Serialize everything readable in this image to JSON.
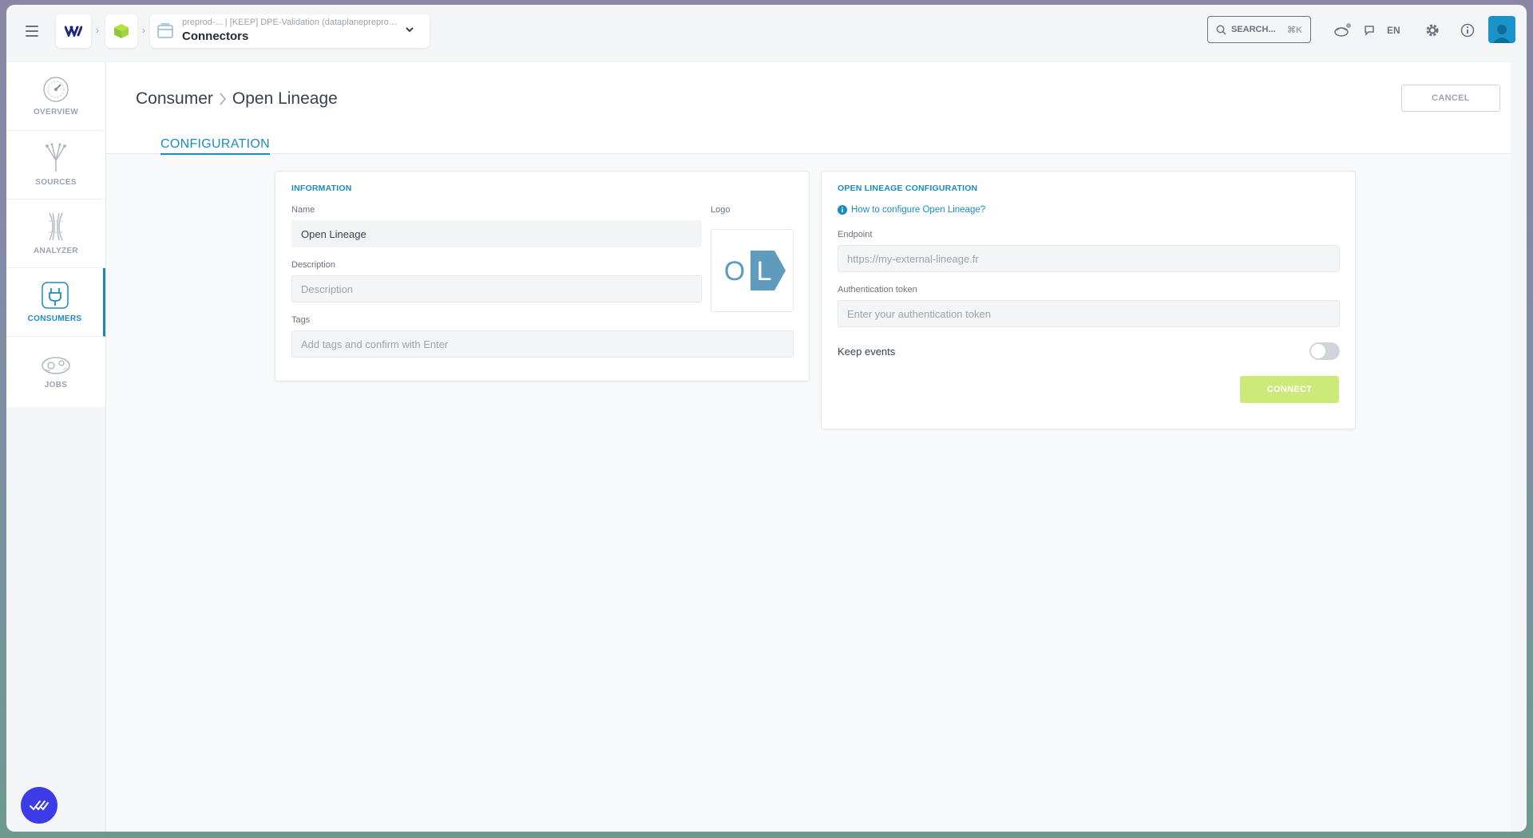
{
  "topbar": {
    "workspace_path": "preprod-...  | [KEEP] DPE-Validation (dataplanepreprod...",
    "workspace_title": "Connectors",
    "search_label": "SEARCH...",
    "search_shortcut": "⌘K",
    "language": "EN"
  },
  "sidebar": {
    "items": [
      {
        "label": "OVERVIEW",
        "icon": "speedometer-icon"
      },
      {
        "label": "SOURCES",
        "icon": "sources-icon"
      },
      {
        "label": "ANALYZER",
        "icon": "analyzer-icon"
      },
      {
        "label": "CONSUMERS",
        "icon": "plug-icon",
        "active": true
      },
      {
        "label": "JOBS",
        "icon": "jobs-icon"
      }
    ]
  },
  "page": {
    "breadcrumb_root": "Consumer",
    "breadcrumb_current": "Open Lineage",
    "cancel_label": "CANCEL",
    "tab_label": "CONFIGURATION"
  },
  "information": {
    "title": "INFORMATION",
    "name_label": "Name",
    "name_value": "Open Lineage",
    "logo_label": "Logo",
    "logo_letters": [
      "O",
      "L"
    ],
    "description_label": "Description",
    "description_placeholder": "Description",
    "tags_label": "Tags",
    "tags_placeholder": "Add tags and confirm with Enter"
  },
  "openlineage": {
    "title": "OPEN LINEAGE CONFIGURATION",
    "help_link": "How to configure Open Lineage?",
    "endpoint_label": "Endpoint",
    "endpoint_placeholder": "https://my-external-lineage.fr",
    "token_label": "Authentication token",
    "token_placeholder": "Enter your authentication token",
    "keep_events_label": "Keep events",
    "keep_events_on": false,
    "connect_label": "CONNECT"
  },
  "colors": {
    "accent": "#1b8cc0",
    "connect_disabled": "#cde97a",
    "fab": "#3b3be8"
  }
}
